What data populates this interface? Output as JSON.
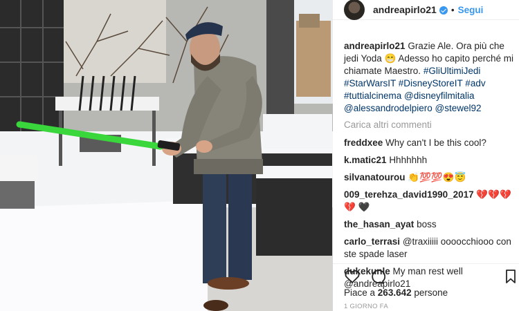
{
  "post": {
    "username": "andreapirlo21",
    "follow_label": "Segui",
    "separator": "•",
    "caption_text": "Grazie Ale. Ora più che jedi Yoda 😁 Adesso ho capito perché mi chiamate Maestro.",
    "caption_tags": "#GliUltimiJedi #StarWarsIT #DisneyStoreIT #adv #tuttialcinema @disneyfilmitalia @alessandrodelpiero @stewel92",
    "load_more": "Carica altri commenti"
  },
  "comments": [
    {
      "user": "freddxee",
      "text": "Why can't I be this cool?"
    },
    {
      "user": "k.matic21",
      "text": "Hhhhhhh"
    },
    {
      "user": "silvanatourou",
      "text": "👏💯💯😍😇"
    },
    {
      "user": "009_terehza_david1990_2017",
      "text": "💔💔💔💔 🖤"
    },
    {
      "user": "the_hasan_ayat",
      "text": "boss"
    },
    {
      "user": "carlo_terrasi",
      "text": "@traxiiiii oooocchiooo con ste spade laser"
    },
    {
      "user": "dukekunle",
      "text": "My man rest well @andreapirlo21"
    }
  ],
  "actions": {
    "like_icon": "heart-icon",
    "comment_icon": "speech-bubble-icon",
    "save_icon": "bookmark-icon"
  },
  "likes": {
    "prefix": "Piace a",
    "count": "263.642",
    "suffix": "persone"
  },
  "timestamp": "1 GIORNO FA",
  "colors": {
    "link": "#003569",
    "follow": "#3897f0",
    "muted": "#999999",
    "lightsaber": "#39d63c"
  }
}
